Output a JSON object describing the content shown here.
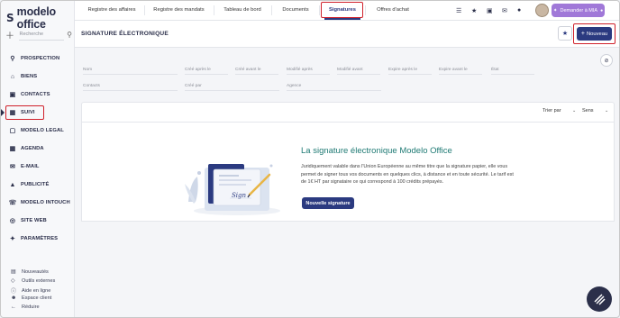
{
  "app": {
    "logo_mark": "S",
    "logo_text": "modelo office"
  },
  "search": {
    "placeholder": "Recherche"
  },
  "nav": [
    {
      "label": "PROSPECTION",
      "icon": "search-icon"
    },
    {
      "label": "BIENS",
      "icon": "home-icon"
    },
    {
      "label": "CONTACTS",
      "icon": "contacts-icon"
    },
    {
      "label": "SUIVI",
      "icon": "calendar-icon"
    },
    {
      "label": "MODELO LEGAL",
      "icon": "legal-icon"
    },
    {
      "label": "AGENDA",
      "icon": "agenda-icon"
    },
    {
      "label": "E-MAIL",
      "icon": "mail-icon"
    },
    {
      "label": "PUBLICITÉ",
      "icon": "megaphone-icon"
    },
    {
      "label": "MODELO INTOUCH",
      "icon": "phone-icon"
    },
    {
      "label": "SITE WEB",
      "icon": "globe-icon"
    },
    {
      "label": "PARAMÈTRES",
      "icon": "wrench-icon"
    }
  ],
  "bottom_links": [
    "Nouveautés",
    "Outils externes",
    "Aide en ligne",
    "Espace client",
    "Réduire"
  ],
  "tabs": [
    "Registre des affaires",
    "Registre des mandats",
    "Tableau de bord",
    "Documents",
    "Signatures",
    "Offres d'achat"
  ],
  "active_tab": "Signatures",
  "topbar": {
    "mia_label": "Demander à MIA"
  },
  "page": {
    "title": "SIGNATURE ÉLECTRONIQUE",
    "new_button": "Nouveau"
  },
  "filters": {
    "row1": [
      "Nom",
      "Créé après le",
      "Créé avant le",
      "Modifié après",
      "Modifié avant",
      "Expire après le",
      "Expire avant le",
      "État"
    ],
    "row2": [
      "Contacts",
      "Créé par",
      "Agence"
    ]
  },
  "sort": {
    "sort_label": "Trier par",
    "direction_label": "Sens"
  },
  "empty_state": {
    "title": "La signature électronique Modelo Office",
    "description": "Juridiquement valable dans l'Union Européenne au même titre que la signature papier, elle vous permet de signer tous vos documents en quelques clics, à distance et en toute sécurité. Le tarif est de 1€ HT par signataire ce qui correspond à 100 crédits prépayés.",
    "button": "Nouvelle signature",
    "signature_text": "Sign"
  },
  "colors": {
    "brand": "#2b3a80",
    "highlight": "#d0202a",
    "mia": "#a078d8",
    "accent_title": "#1f7a74"
  }
}
